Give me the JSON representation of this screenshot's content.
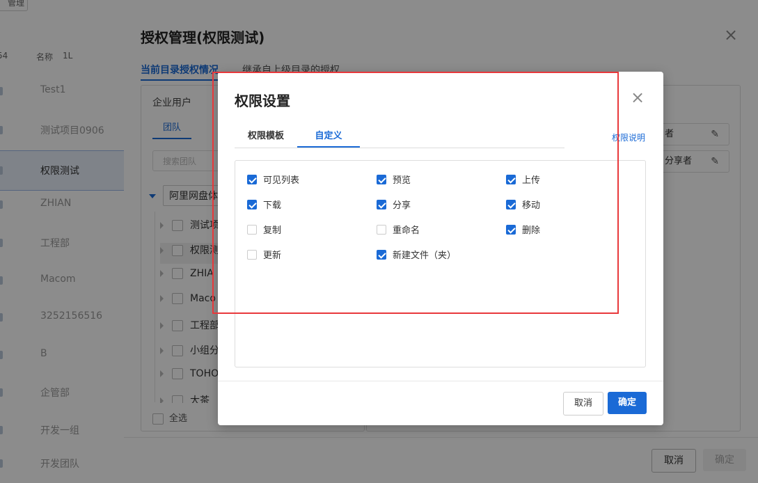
{
  "background": {
    "top_button": "管理",
    "col_count": "54",
    "col_name": "名称",
    "col_sort": "1L",
    "rows": [
      "Test1",
      "测试项目0906",
      "权限测试",
      "ZHIAN",
      "工程部",
      "Macom",
      "3252156516",
      "B",
      "企管部",
      "开发一组",
      "开发团队"
    ]
  },
  "outer_dialog": {
    "title": "授权管理(权限测试)",
    "close_icon": "×",
    "tab_current": "当前目录授权情况",
    "tab_inherited": "继承自上级目录的授权",
    "enterprise_users": "企业用户",
    "team_tab": "团队",
    "team_search_placeholder": "搜索团队",
    "tree_root": "阿里网盘体验",
    "tree_items": [
      "测试项",
      "权限测",
      "ZHIA",
      "Maco",
      "工程部",
      "小组分",
      "TOHO",
      "大茶",
      "全选"
    ],
    "right_rows": [
      "者",
      "分享者"
    ],
    "edit_icon": "✎",
    "cancel": "取消",
    "confirm": "确定"
  },
  "modal": {
    "title": "权限设置",
    "close_icon": "×",
    "tabs": [
      "权限模板",
      "自定义"
    ],
    "active_tab": "自定义",
    "help_link": "权限说明",
    "permissions": [
      {
        "label": "可见列表",
        "checked": true
      },
      {
        "label": "预览",
        "checked": true
      },
      {
        "label": "上传",
        "checked": true
      },
      {
        "label": "下载",
        "checked": true
      },
      {
        "label": "分享",
        "checked": true
      },
      {
        "label": "移动",
        "checked": true
      },
      {
        "label": "复制",
        "checked": false
      },
      {
        "label": "重命名",
        "checked": false
      },
      {
        "label": "删除",
        "checked": true
      },
      {
        "label": "更新",
        "checked": false
      },
      {
        "label": "新建文件（夹）",
        "checked": true
      }
    ],
    "cancel": "取消",
    "confirm": "确定"
  },
  "colors": {
    "accent": "#1a6ad6",
    "annotation_border": "#e8383b",
    "overlay": "rgba(0,0,0,0.45)"
  }
}
